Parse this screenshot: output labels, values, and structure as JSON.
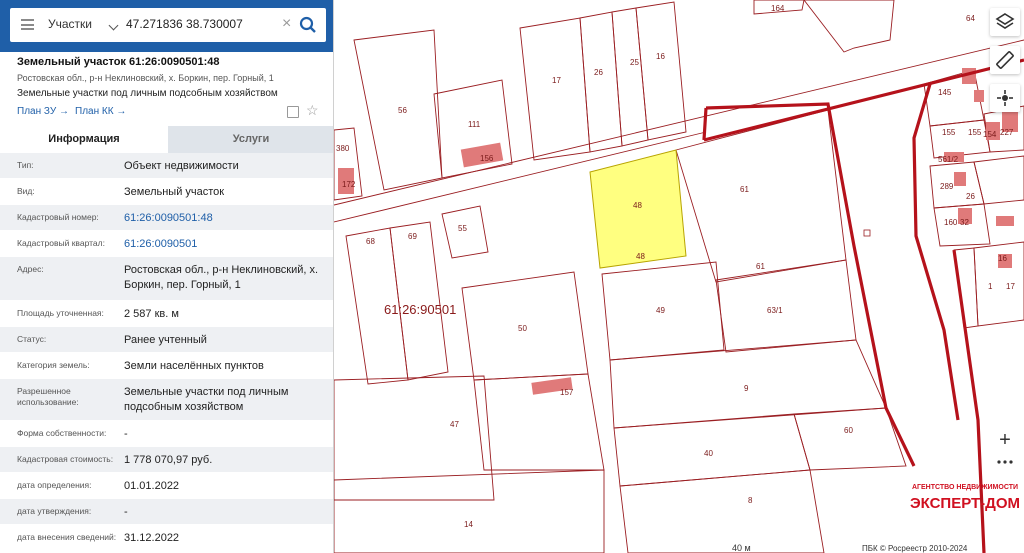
{
  "search": {
    "category": "Участки",
    "query": "47.271836 38.730007",
    "clear_glyph": "×"
  },
  "parcel": {
    "title": "Земельный участок 61:26:0090501:48",
    "address": "Ростовская обл., р-н Неклиновский, х. Боркин, пер. Горный, 1",
    "usage": "Земельные участки под личным подсобным хозяйством",
    "plan_zu": "План ЗУ →",
    "plan_kk": "План КК →"
  },
  "tabs": {
    "info": "Информация",
    "services": "Услуги"
  },
  "attributes": [
    {
      "label": "Тип:",
      "value": "Объект недвижимости",
      "link": false
    },
    {
      "label": "Вид:",
      "value": "Земельный участок",
      "link": false
    },
    {
      "label": "Кадастровый номер:",
      "value": "61:26:0090501:48",
      "link": true
    },
    {
      "label": "Кадастровый квартал:",
      "value": "61:26:0090501",
      "link": true
    },
    {
      "label": "Адрес:",
      "value": "Ростовская обл., р-н Неклиновский, х. Боркин, пер. Горный, 1",
      "link": false
    },
    {
      "label": "Площадь уточненная:",
      "value": "2 587 кв. м",
      "link": false
    },
    {
      "label": "Статус:",
      "value": "Ранее учтенный",
      "link": false
    },
    {
      "label": "Категория земель:",
      "value": "Земли населённых пунктов",
      "link": false
    },
    {
      "label": "Разрешенное использование:",
      "value": "Земельные участки под личным подсобным хозяйством",
      "link": false
    },
    {
      "label": "Форма собственности:",
      "value": "-",
      "link": false
    },
    {
      "label": "Кадастровая стоимость:",
      "value": "1 778 070,97 руб.",
      "link": false
    },
    {
      "label": "дата определения:",
      "value": "01.01.2022",
      "link": false
    },
    {
      "label": "дата утверждения:",
      "value": "-",
      "link": false
    },
    {
      "label": "дата внесения сведений:",
      "value": "31.12.2022",
      "link": false
    }
  ],
  "map": {
    "quarter_label": "61:26:90501",
    "parcel_labels": [
      "164",
      "64",
      "17",
      "26",
      "25",
      "16",
      "56",
      "111",
      "156",
      "380",
      "172",
      "68",
      "69",
      "55",
      "48",
      "48",
      "61",
      "61",
      "49",
      "63/1",
      "50",
      "157",
      "47",
      "9",
      "60",
      "40",
      "8",
      "14",
      "145",
      "155",
      "155",
      "154",
      "227",
      "561/2",
      "289",
      "26",
      "160",
      "32",
      "16",
      "1",
      "17"
    ],
    "selected_fill": "#ffff80",
    "boundary_color": "#b5121b",
    "scale_label": "40 м",
    "copyright": "ПБК © Росреестр 2010-2024"
  },
  "watermark": {
    "line1": "АГЕНТСТВО НЕДВИЖИМОСТИ",
    "line2": "ЭКСПЕРТ-ДОМ"
  },
  "controls": {
    "zoom_in": "+",
    "icons": [
      "layers-icon",
      "ruler-icon",
      "locate-icon",
      "more-icon"
    ]
  }
}
